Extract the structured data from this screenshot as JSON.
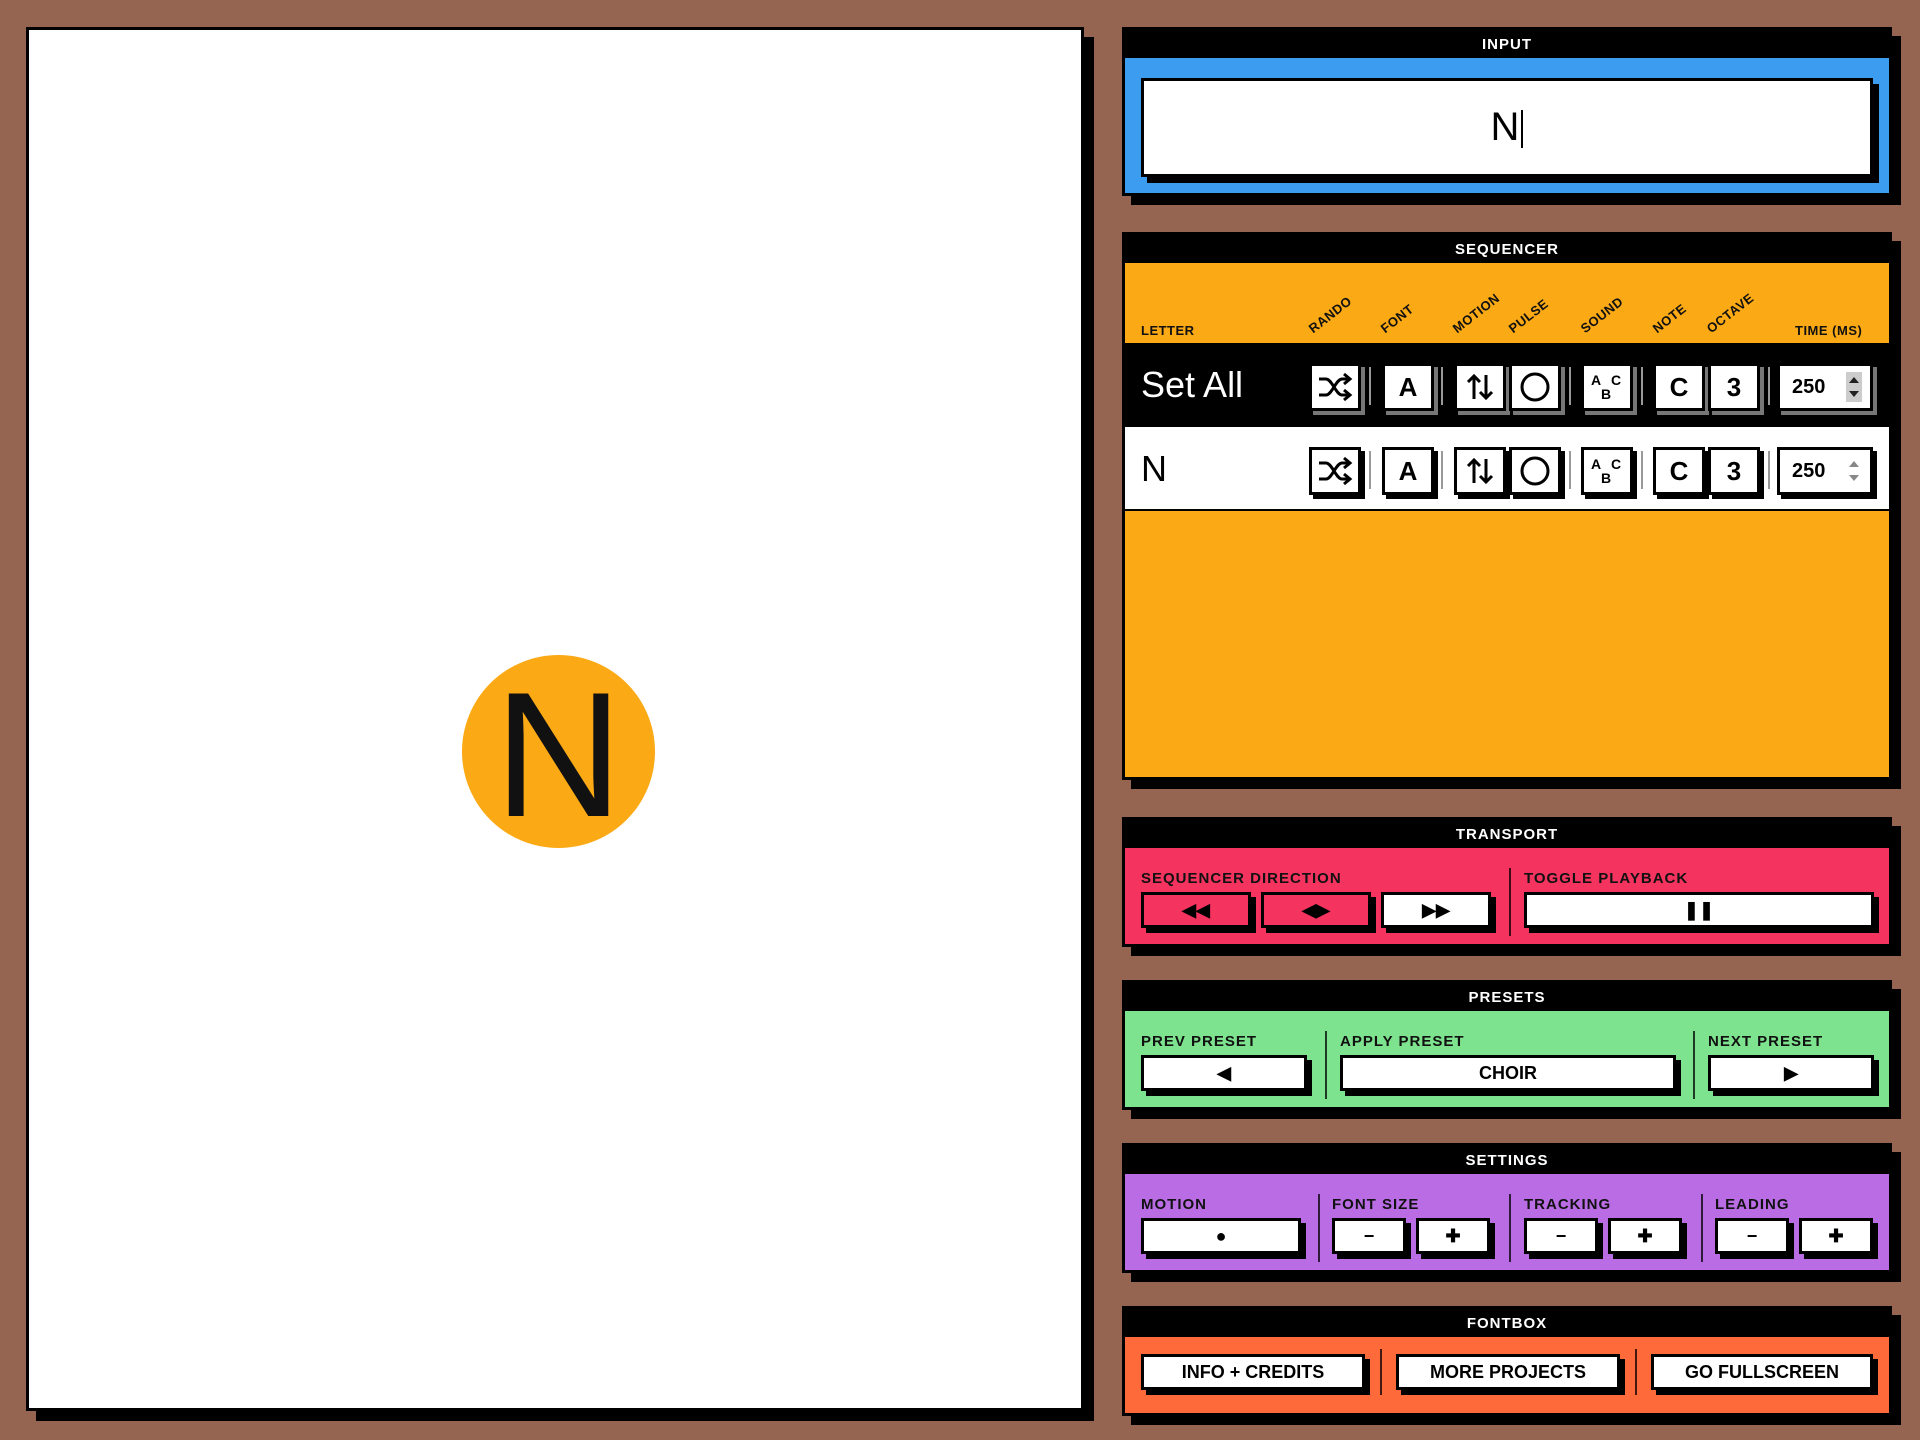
{
  "canvas": {
    "letter": "N",
    "disc_color": "#fba914"
  },
  "input": {
    "title": "INPUT",
    "value": "N",
    "accent": "#3b9cf0"
  },
  "sequencer": {
    "title": "SEQUENCER",
    "accent": "#fba914",
    "columns": [
      "LETTER",
      "RANDO",
      "FONT",
      "MOTION",
      "PULSE",
      "SOUND",
      "NOTE",
      "OCTAVE",
      "TIME (MS)"
    ],
    "rows": [
      {
        "label": "Set All",
        "font": "A",
        "note": "C",
        "octave": "3",
        "time": "250"
      },
      {
        "label": "N",
        "font": "A",
        "note": "C",
        "octave": "3",
        "time": "250"
      }
    ]
  },
  "transport": {
    "title": "TRANSPORT",
    "accent": "#f4335f",
    "direction_label": "SEQUENCER DIRECTION",
    "playback_label": "TOGGLE PLAYBACK",
    "direction_buttons": [
      "◀◀",
      "◀▶",
      "▶▶"
    ],
    "playback_icon": "❚❚"
  },
  "presets": {
    "title": "PRESETS",
    "accent": "#7ee38f",
    "prev_label": "PREV PRESET",
    "apply_label": "APPLY PRESET",
    "next_label": "NEXT PRESET",
    "prev_icon": "◀",
    "current": "CHOIR",
    "next_icon": "▶"
  },
  "settings": {
    "title": "SETTINGS",
    "accent": "#b96ce4",
    "motion_label": "MOTION",
    "font_size_label": "FONT SIZE",
    "tracking_label": "TRACKING",
    "leading_label": "LEADING",
    "minus": "−",
    "plus": "✚",
    "motion_icon": "●"
  },
  "fontbox": {
    "title": "FONTBOX",
    "accent": "#ff6a3a",
    "buttons": [
      "INFO + CREDITS",
      "MORE PROJECTS",
      "GO FULLSCREEN"
    ]
  }
}
